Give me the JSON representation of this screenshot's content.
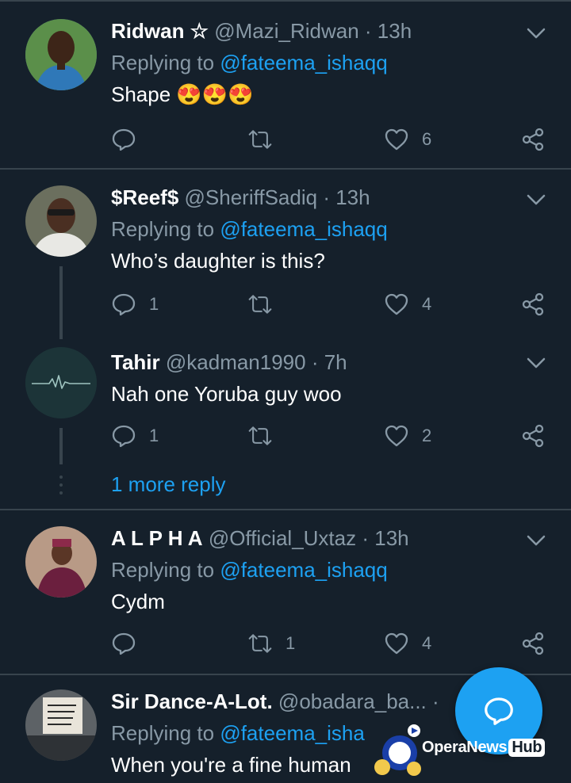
{
  "colors": {
    "background": "#15202b",
    "divider": "#38444d",
    "muted": "#8899a6",
    "accent": "#1da1f2",
    "like_hollow": "#8899a6"
  },
  "tweets": [
    {
      "name": "Ridwan ☆",
      "handle": "@Mazi_Ridwan",
      "time": "· 13h",
      "replying_prefix": "Replying to ",
      "replying_to": "@fateema_ishaqq",
      "text": "Shape 😍😍😍",
      "replies": "",
      "retweets": "",
      "likes": "6",
      "avatar_icon": "profile-photo"
    },
    {
      "name": "$Reef$",
      "handle": "@SheriffSadiq",
      "time": "· 13h",
      "replying_prefix": "Replying to ",
      "replying_to": "@fateema_ishaqq",
      "text": "Who’s daughter is this?",
      "replies": "1",
      "retweets": "",
      "likes": "4",
      "avatar_icon": "profile-photo"
    },
    {
      "name": "Tahir",
      "handle": "@kadman1990",
      "time": "· 7h",
      "text": "Nah one Yoruba guy woo",
      "replies": "1",
      "retweets": "",
      "likes": "2",
      "avatar_icon": "heartbeat-logo"
    },
    {
      "name": "A L P H A",
      "handle": "@Official_Uxtaz",
      "time": "· 13h",
      "replying_prefix": "Replying to ",
      "replying_to": "@fateema_ishaqq",
      "text": "Cydm",
      "replies": "",
      "retweets": "1",
      "likes": "4",
      "avatar_icon": "profile-photo"
    },
    {
      "name": "Sir Dance-A-Lot.",
      "handle": "@obadara_ba...",
      "time": "·",
      "replying_prefix": "Replying to ",
      "replying_to": "@fateema_isha",
      "text": "When you're a fine human",
      "avatar_icon": "profile-photo"
    }
  ],
  "more_replies": "1 more reply",
  "fab_icon": "compose-reply-icon",
  "watermark": {
    "brand": "OperaNews",
    "badge": "Hub"
  }
}
